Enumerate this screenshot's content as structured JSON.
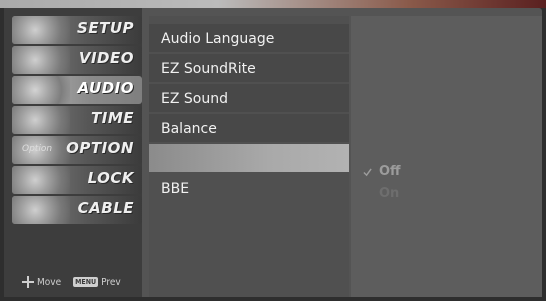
{
  "nav": {
    "items": [
      {
        "label": "SETUP"
      },
      {
        "label": "VIDEO"
      },
      {
        "label": "AUDIO"
      },
      {
        "label": "TIME"
      },
      {
        "label": "OPTION"
      },
      {
        "label": "LOCK"
      },
      {
        "label": "CABLE"
      }
    ],
    "option_badge": "Option"
  },
  "options": {
    "items": [
      {
        "label": "Audio Language"
      },
      {
        "label": "EZ SoundRite"
      },
      {
        "label": "EZ Sound"
      },
      {
        "label": "Balance"
      },
      {
        "label": ""
      },
      {
        "label": "BBE"
      }
    ]
  },
  "submenu": {
    "items": [
      {
        "label": "Off",
        "checked": true
      },
      {
        "label": "On",
        "checked": false
      }
    ]
  },
  "hints": {
    "move_label": "Move",
    "menu_key": "MENU",
    "prev_label": "Prev"
  },
  "colors": {
    "background": "#2e2e2e",
    "nav_bg": "#3d3d3d",
    "options_bg": "#505050",
    "submenu_bg": "#5d5d5d",
    "highlight": "#a9a9a9"
  }
}
